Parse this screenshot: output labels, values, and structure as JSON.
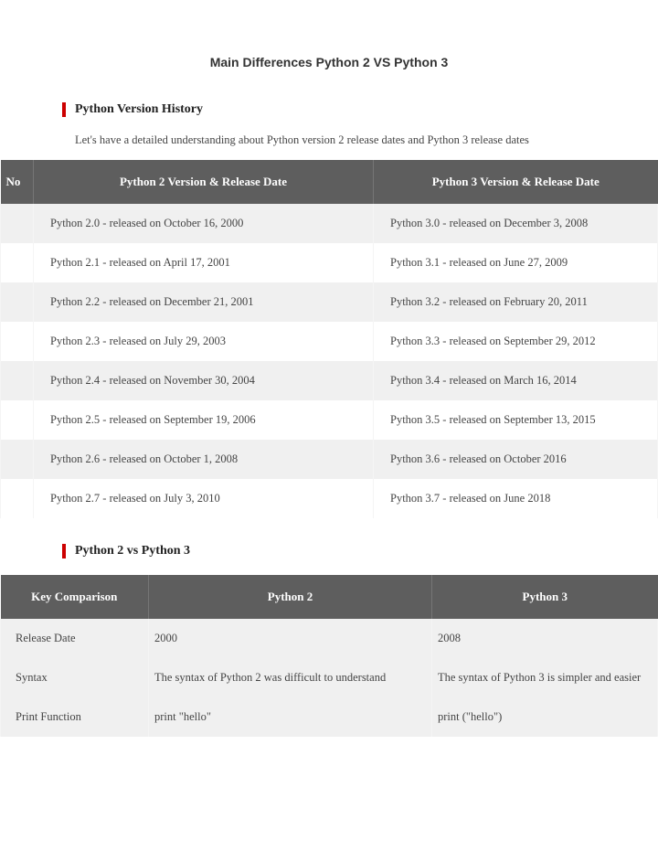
{
  "title": "Main Differences Python 2 VS Python 3",
  "section1": {
    "heading": "Python Version History",
    "intro": "Let's have a detailed understanding about Python version 2 release dates and Python 3 release dates",
    "headers": {
      "no": "No",
      "col1": "Python 2 Version & Release Date",
      "col2": "Python 3 Version & Release Date"
    },
    "rows": [
      {
        "p2": "Python 2.0 - released on October 16, 2000",
        "p3": "Python 3.0 - released on December 3, 2008"
      },
      {
        "p2": "Python 2.1 - released on April 17, 2001",
        "p3": "Python 3.1 - released on June 27, 2009"
      },
      {
        "p2": "Python 2.2 - released on December 21, 2001",
        "p3": "Python 3.2 - released on February 20, 2011"
      },
      {
        "p2": "Python 2.3 - released on July 29, 2003",
        "p3": "Python 3.3 - released on September 29, 2012"
      },
      {
        "p2": "Python 2.4 - released on November 30, 2004",
        "p3": "Python 3.4 - released on March 16, 2014"
      },
      {
        "p2": "Python 2.5 - released on September 19, 2006",
        "p3": "Python 3.5 - released on September 13, 2015"
      },
      {
        "p2": "Python 2.6 - released on October 1, 2008",
        "p3": "Python 3.6 - released on October 2016"
      },
      {
        "p2": "Python 2.7 - released on July 3, 2010",
        "p3": "Python 3.7 - released on June 2018"
      }
    ]
  },
  "section2": {
    "heading": "Python 2 vs Python 3",
    "headers": {
      "key": "Key Comparison",
      "p2": "Python 2",
      "p3": "Python 3"
    },
    "rows": [
      {
        "key": "Release Date",
        "p2": "2000",
        "p3": "2008"
      },
      {
        "key": "Syntax",
        "p2": "The syntax of Python 2 was difficult to understand",
        "p3": "The syntax of Python 3 is simpler and easier"
      },
      {
        "key": "Print Function",
        "p2": "print \"hello\"",
        "p3": "print (\"hello\")"
      }
    ]
  }
}
